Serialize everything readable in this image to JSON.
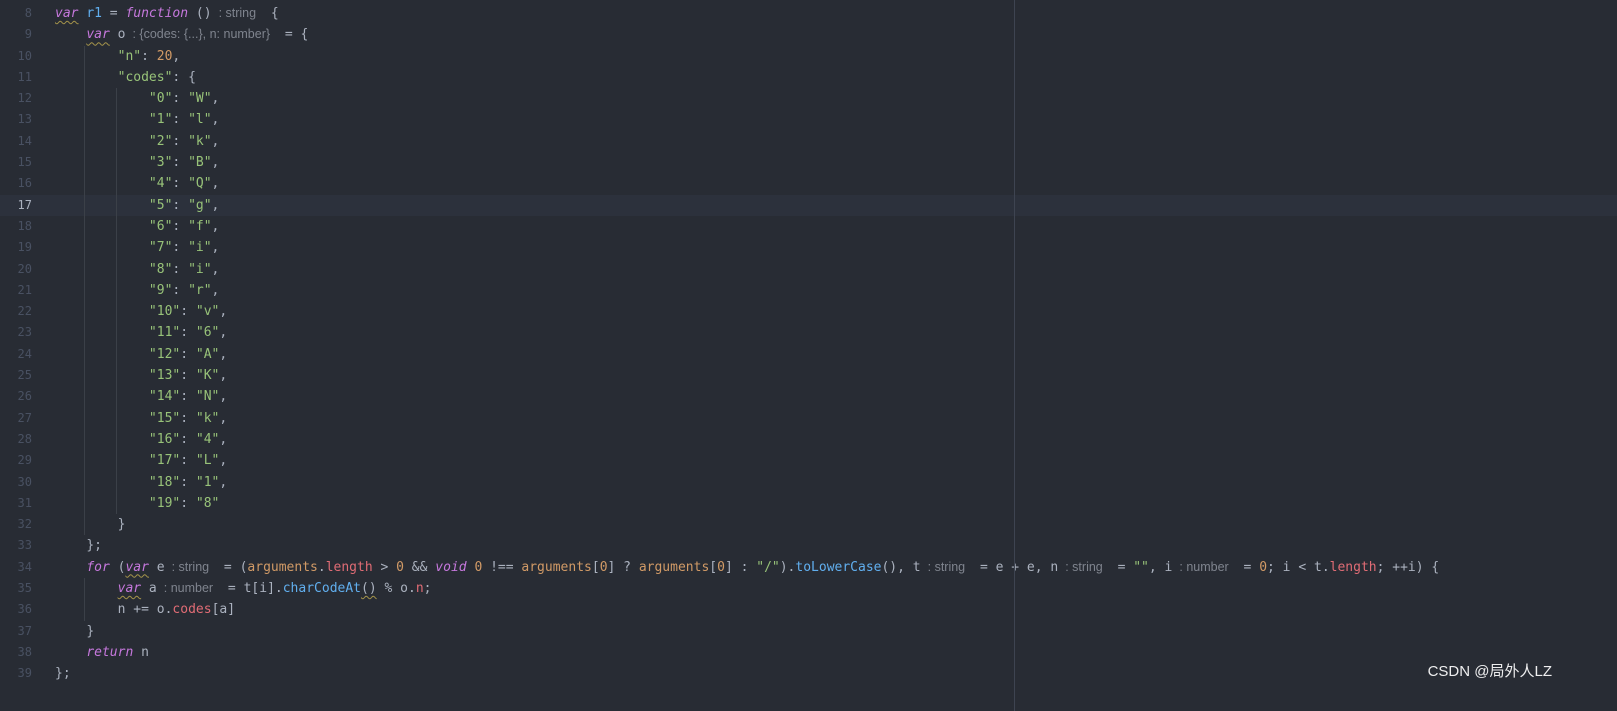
{
  "colors": {
    "background": "#282c34",
    "text": "#abb2bf",
    "line_number": "#495162",
    "current_line_number": "#abb2bf",
    "current_line": "#2c313c",
    "keyword": "#c678dd",
    "string": "#98c379",
    "number": "#d19a66",
    "function": "#61afef",
    "property": "#e06c75",
    "arguments": "#d19a66",
    "inlay_hint": "#7f848e",
    "indent_guide": "#3b4048",
    "right_margin": "#3e4451",
    "warning_underline": "#a5944a",
    "watermark": "#ffffff"
  },
  "editor": {
    "current_line": 17,
    "lines": [
      {
        "n": "8",
        "indent": 0,
        "tokens": [
          [
            "var",
            "kwu"
          ],
          [
            " ",
            "p"
          ],
          [
            "r1",
            "fn"
          ],
          [
            " = ",
            "p"
          ],
          [
            "function",
            "kw"
          ],
          [
            " ()",
            "p"
          ],
          [
            ": string",
            "hint"
          ],
          [
            " {",
            "p"
          ]
        ]
      },
      {
        "n": "9",
        "indent": 4,
        "tokens": [
          [
            "var",
            "kwu"
          ],
          [
            " o",
            "p"
          ],
          [
            ": {codes: {...}, n: number}",
            "hint"
          ],
          [
            " = {",
            "p"
          ]
        ]
      },
      {
        "n": "10",
        "indent": 8,
        "tokens": [
          [
            "\"n\"",
            "str"
          ],
          [
            ": ",
            "p"
          ],
          [
            "20",
            "num"
          ],
          [
            ",",
            "p"
          ]
        ]
      },
      {
        "n": "11",
        "indent": 8,
        "tokens": [
          [
            "\"codes\"",
            "str"
          ],
          [
            ": {",
            "p"
          ]
        ]
      },
      {
        "n": "12",
        "indent": 12,
        "tokens": [
          [
            "\"0\"",
            "str"
          ],
          [
            ": ",
            "p"
          ],
          [
            "\"W\"",
            "str"
          ],
          [
            ",",
            "p"
          ]
        ]
      },
      {
        "n": "13",
        "indent": 12,
        "tokens": [
          [
            "\"1\"",
            "str"
          ],
          [
            ": ",
            "p"
          ],
          [
            "\"l\"",
            "str"
          ],
          [
            ",",
            "p"
          ]
        ]
      },
      {
        "n": "14",
        "indent": 12,
        "tokens": [
          [
            "\"2\"",
            "str"
          ],
          [
            ": ",
            "p"
          ],
          [
            "\"k\"",
            "str"
          ],
          [
            ",",
            "p"
          ]
        ]
      },
      {
        "n": "15",
        "indent": 12,
        "tokens": [
          [
            "\"3\"",
            "str"
          ],
          [
            ": ",
            "p"
          ],
          [
            "\"B\"",
            "str"
          ],
          [
            ",",
            "p"
          ]
        ]
      },
      {
        "n": "16",
        "indent": 12,
        "tokens": [
          [
            "\"4\"",
            "str"
          ],
          [
            ": ",
            "p"
          ],
          [
            "\"Q\"",
            "str"
          ],
          [
            ",",
            "p"
          ]
        ]
      },
      {
        "n": "17",
        "indent": 12,
        "tokens": [
          [
            "\"5\"",
            "str"
          ],
          [
            ": ",
            "p"
          ],
          [
            "\"g\"",
            "str"
          ],
          [
            ",",
            "p"
          ]
        ]
      },
      {
        "n": "18",
        "indent": 12,
        "tokens": [
          [
            "\"6\"",
            "str"
          ],
          [
            ": ",
            "p"
          ],
          [
            "\"f\"",
            "str"
          ],
          [
            ",",
            "p"
          ]
        ]
      },
      {
        "n": "19",
        "indent": 12,
        "tokens": [
          [
            "\"7\"",
            "str"
          ],
          [
            ": ",
            "p"
          ],
          [
            "\"i\"",
            "str"
          ],
          [
            ",",
            "p"
          ]
        ]
      },
      {
        "n": "20",
        "indent": 12,
        "tokens": [
          [
            "\"8\"",
            "str"
          ],
          [
            ": ",
            "p"
          ],
          [
            "\"i\"",
            "str"
          ],
          [
            ",",
            "p"
          ]
        ]
      },
      {
        "n": "21",
        "indent": 12,
        "tokens": [
          [
            "\"9\"",
            "str"
          ],
          [
            ": ",
            "p"
          ],
          [
            "\"r\"",
            "str"
          ],
          [
            ",",
            "p"
          ]
        ]
      },
      {
        "n": "22",
        "indent": 12,
        "tokens": [
          [
            "\"10\"",
            "str"
          ],
          [
            ": ",
            "p"
          ],
          [
            "\"v\"",
            "str"
          ],
          [
            ",",
            "p"
          ]
        ]
      },
      {
        "n": "23",
        "indent": 12,
        "tokens": [
          [
            "\"11\"",
            "str"
          ],
          [
            ": ",
            "p"
          ],
          [
            "\"6\"",
            "str"
          ],
          [
            ",",
            "p"
          ]
        ]
      },
      {
        "n": "24",
        "indent": 12,
        "tokens": [
          [
            "\"12\"",
            "str"
          ],
          [
            ": ",
            "p"
          ],
          [
            "\"A\"",
            "str"
          ],
          [
            ",",
            "p"
          ]
        ]
      },
      {
        "n": "25",
        "indent": 12,
        "tokens": [
          [
            "\"13\"",
            "str"
          ],
          [
            ": ",
            "p"
          ],
          [
            "\"K\"",
            "str"
          ],
          [
            ",",
            "p"
          ]
        ]
      },
      {
        "n": "26",
        "indent": 12,
        "tokens": [
          [
            "\"14\"",
            "str"
          ],
          [
            ": ",
            "p"
          ],
          [
            "\"N\"",
            "str"
          ],
          [
            ",",
            "p"
          ]
        ]
      },
      {
        "n": "27",
        "indent": 12,
        "tokens": [
          [
            "\"15\"",
            "str"
          ],
          [
            ": ",
            "p"
          ],
          [
            "\"k\"",
            "str"
          ],
          [
            ",",
            "p"
          ]
        ]
      },
      {
        "n": "28",
        "indent": 12,
        "tokens": [
          [
            "\"16\"",
            "str"
          ],
          [
            ": ",
            "p"
          ],
          [
            "\"4\"",
            "str"
          ],
          [
            ",",
            "p"
          ]
        ]
      },
      {
        "n": "29",
        "indent": 12,
        "tokens": [
          [
            "\"17\"",
            "str"
          ],
          [
            ": ",
            "p"
          ],
          [
            "\"L\"",
            "str"
          ],
          [
            ",",
            "p"
          ]
        ]
      },
      {
        "n": "30",
        "indent": 12,
        "tokens": [
          [
            "\"18\"",
            "str"
          ],
          [
            ": ",
            "p"
          ],
          [
            "\"1\"",
            "str"
          ],
          [
            ",",
            "p"
          ]
        ]
      },
      {
        "n": "31",
        "indent": 12,
        "tokens": [
          [
            "\"19\"",
            "str"
          ],
          [
            ": ",
            "p"
          ],
          [
            "\"8\"",
            "str"
          ]
        ]
      },
      {
        "n": "32",
        "indent": 8,
        "tokens": [
          [
            "}",
            "p"
          ]
        ]
      },
      {
        "n": "33",
        "indent": 4,
        "tokens": [
          [
            "};",
            "p"
          ]
        ]
      },
      {
        "n": "34",
        "indent": 4,
        "tokens": [
          [
            "for",
            "kw"
          ],
          [
            " (",
            "p"
          ],
          [
            "var",
            "kwu"
          ],
          [
            " e",
            "p"
          ],
          [
            ": string",
            "hint"
          ],
          [
            " = (",
            "p"
          ],
          [
            "arguments",
            "arg"
          ],
          [
            ".",
            "p"
          ],
          [
            "length",
            "prop"
          ],
          [
            " > ",
            "p"
          ],
          [
            "0",
            "num"
          ],
          [
            " && ",
            "p"
          ],
          [
            "void",
            "kw"
          ],
          [
            " ",
            "p"
          ],
          [
            "0",
            "num"
          ],
          [
            " !== ",
            "p"
          ],
          [
            "arguments",
            "arg"
          ],
          [
            "[",
            "p"
          ],
          [
            "0",
            "num"
          ],
          [
            "] ? ",
            "p"
          ],
          [
            "arguments",
            "arg"
          ],
          [
            "[",
            "p"
          ],
          [
            "0",
            "num"
          ],
          [
            "] : ",
            "p"
          ],
          [
            "\"/\"",
            "str"
          ],
          [
            ").",
            "p"
          ],
          [
            "toLowerCase",
            "fn"
          ],
          [
            "(), t",
            "p"
          ],
          [
            ": string",
            "hint"
          ],
          [
            " = e + e, n",
            "p"
          ],
          [
            ": string",
            "hint"
          ],
          [
            " = ",
            "p"
          ],
          [
            "\"\"",
            "str"
          ],
          [
            ", i",
            "p"
          ],
          [
            ": number",
            "hint"
          ],
          [
            " = ",
            "p"
          ],
          [
            "0",
            "num"
          ],
          [
            "; i < t.",
            "p"
          ],
          [
            "length",
            "prop"
          ],
          [
            "; ++i) {",
            "p"
          ]
        ]
      },
      {
        "n": "35",
        "indent": 8,
        "tokens": [
          [
            "var",
            "kwu"
          ],
          [
            " a",
            "p"
          ],
          [
            ": number",
            "hint"
          ],
          [
            " = t[i].",
            "p"
          ],
          [
            "charCodeAt",
            "fn"
          ],
          [
            "()",
            "warn"
          ],
          [
            " % o.",
            "p"
          ],
          [
            "n",
            "prop"
          ],
          [
            ";",
            "p"
          ]
        ]
      },
      {
        "n": "36",
        "indent": 8,
        "tokens": [
          [
            "n += o.",
            "p"
          ],
          [
            "codes",
            "prop"
          ],
          [
            "[a]",
            "p"
          ]
        ]
      },
      {
        "n": "37",
        "indent": 4,
        "tokens": [
          [
            "}",
            "p"
          ]
        ]
      },
      {
        "n": "38",
        "indent": 4,
        "tokens": [
          [
            "return",
            "kw"
          ],
          [
            " n",
            "p"
          ]
        ]
      },
      {
        "n": "39",
        "indent": 0,
        "tokens": [
          [
            "};",
            "p"
          ]
        ]
      }
    ]
  },
  "watermark": "CSDN @局外人LZ"
}
